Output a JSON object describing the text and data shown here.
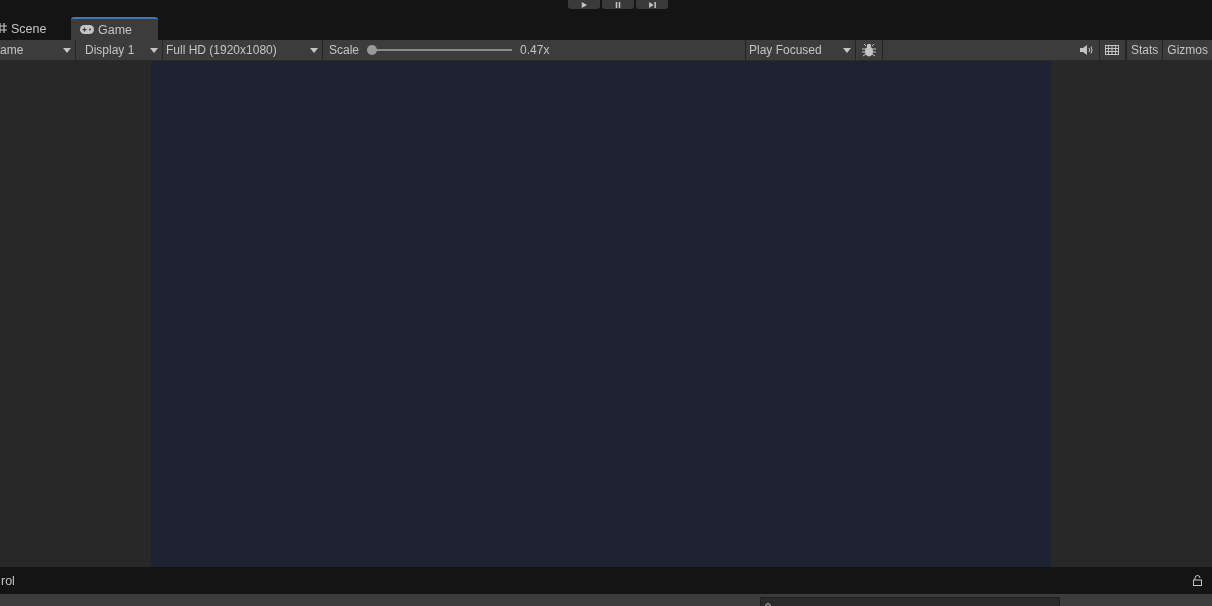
{
  "play_controls": [
    {
      "kind": "play"
    },
    {
      "kind": "pause"
    },
    {
      "kind": "step"
    }
  ],
  "tabs": [
    {
      "label": "Scene",
      "kind": "scene",
      "selected": false
    },
    {
      "label": "Game",
      "kind": "game",
      "selected": true
    }
  ],
  "toolbar": {
    "view_dropdown": "ame",
    "display_dropdown": "Display 1",
    "resolution_dropdown": "Full HD (1920x1080)",
    "scale": {
      "label": "Scale",
      "level": 0,
      "reading": "0.47x"
    },
    "play_mode_dropdown": "Play Focused",
    "stats_button": "Stats",
    "gizmos_button": "Gizmos"
  },
  "bottom_panel": {
    "title": "rol"
  }
}
